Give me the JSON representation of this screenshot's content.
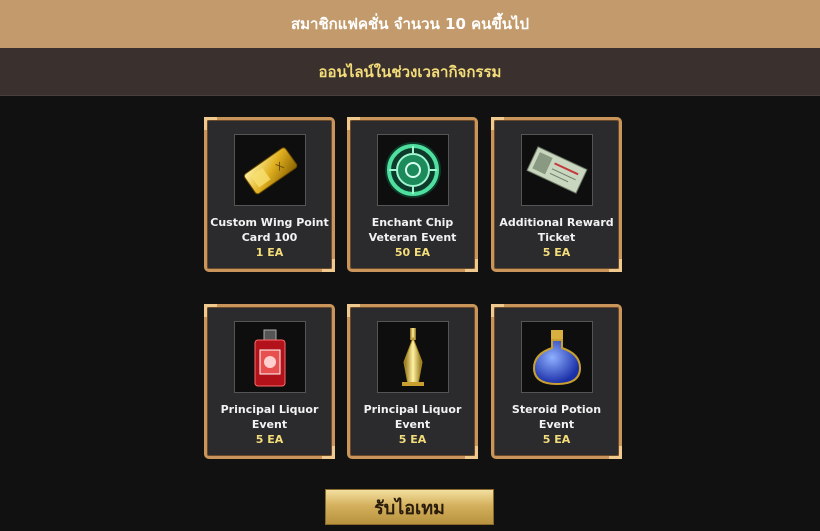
{
  "header": {
    "title": "สมาชิกแฟคชั่น จำนวน 10 คนขึ้นไป",
    "subtitle": "ออนไลน์ในช่วงเวลากิจกรรม"
  },
  "items": [
    {
      "name": "Custom Wing Point Card 100",
      "qty": "1 EA",
      "icon": "gold-card-icon"
    },
    {
      "name": "Enchant Chip Veteran Event",
      "qty": "50 EA",
      "icon": "green-chip-icon"
    },
    {
      "name": "Additional Reward Ticket",
      "qty": "5 EA",
      "icon": "ticket-icon"
    },
    {
      "name": "Principal Liquor Event",
      "qty": "5 EA",
      "icon": "red-liquor-bottle-icon"
    },
    {
      "name": "Principal Liquor Event",
      "qty": "5 EA",
      "icon": "gold-liquor-bottle-icon"
    },
    {
      "name": "Steroid Potion Event",
      "qty": "5 EA",
      "icon": "blue-potion-icon"
    }
  ],
  "claim_button": {
    "label": "รับไอเทม"
  },
  "colors": {
    "top_banner": "#c29a6b",
    "sub_banner": "#3a302d",
    "accent_gold": "#f3dc7a",
    "card_border": "#c9955a"
  }
}
